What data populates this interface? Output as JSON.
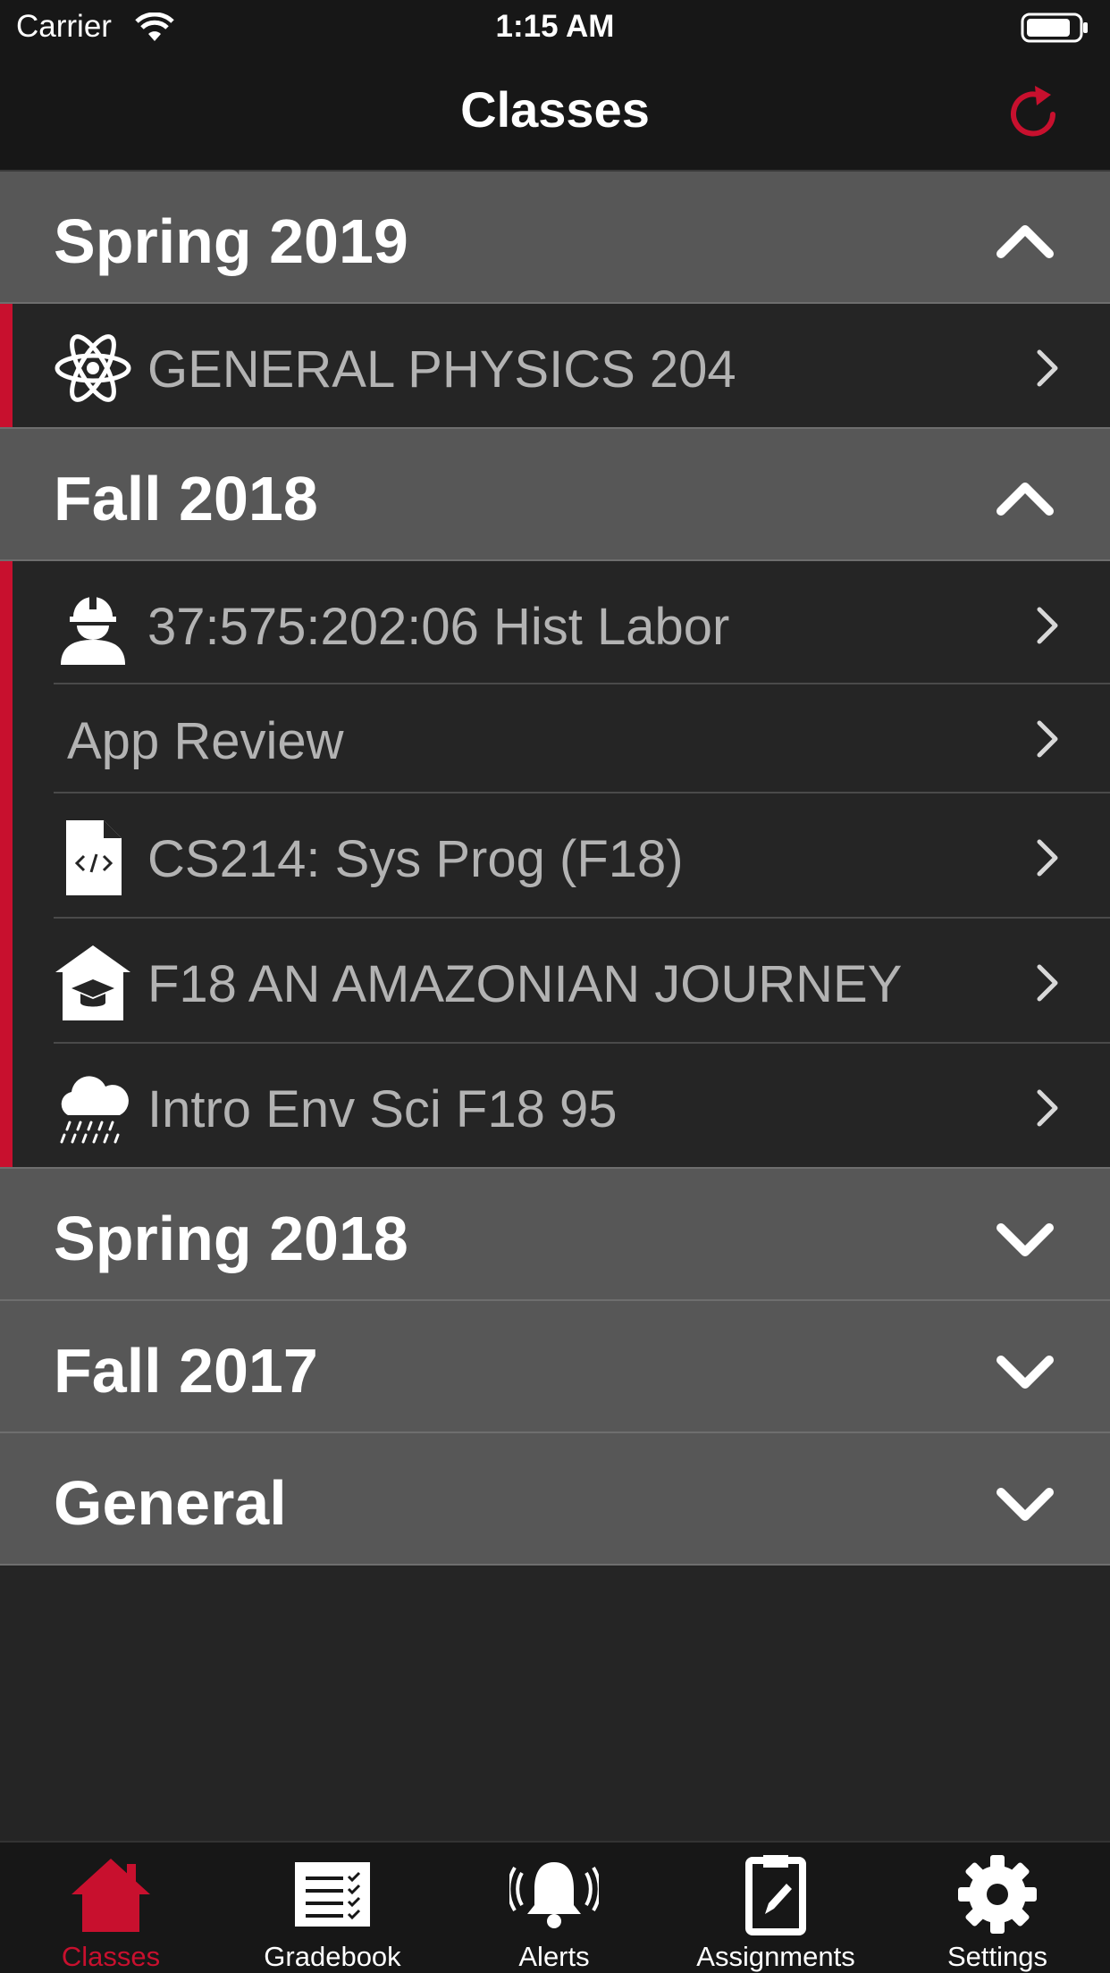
{
  "status": {
    "carrier": "Carrier",
    "time": "1:15 AM"
  },
  "header": {
    "title": "Classes"
  },
  "sections": [
    {
      "title": "Spring 2019",
      "expanded": true
    },
    {
      "title": "Fall 2018",
      "expanded": true
    },
    {
      "title": "Spring 2018",
      "expanded": false
    },
    {
      "title": "Fall 2017",
      "expanded": false
    },
    {
      "title": "General",
      "expanded": false
    }
  ],
  "classes": {
    "spring2019": [
      {
        "label": "GENERAL PHYSICS 204",
        "icon": "atom-icon"
      }
    ],
    "fall2018": [
      {
        "label": "37:575:202:06 Hist Labor",
        "icon": "worker-icon"
      },
      {
        "label": "App Review",
        "icon": ""
      },
      {
        "label": "CS214: Sys Prog (F18)",
        "icon": "code-file-icon"
      },
      {
        "label": "F18 AN AMAZONIAN JOURNEY",
        "icon": "graduation-house-icon"
      },
      {
        "label": "Intro Env Sci F18 95",
        "icon": "rain-cloud-icon"
      }
    ]
  },
  "tabs": [
    {
      "label": "Classes",
      "icon": "home-icon",
      "active": true
    },
    {
      "label": "Gradebook",
      "icon": "gradebook-icon",
      "active": false
    },
    {
      "label": "Alerts",
      "icon": "bell-icon",
      "active": false
    },
    {
      "label": "Assignments",
      "icon": "clipboard-icon",
      "active": false
    },
    {
      "label": "Settings",
      "icon": "gear-icon",
      "active": false
    }
  ],
  "colors": {
    "accent": "#c8102e",
    "header_bg": "#575757",
    "row_bg": "#252525",
    "bar_bg": "#171717"
  }
}
